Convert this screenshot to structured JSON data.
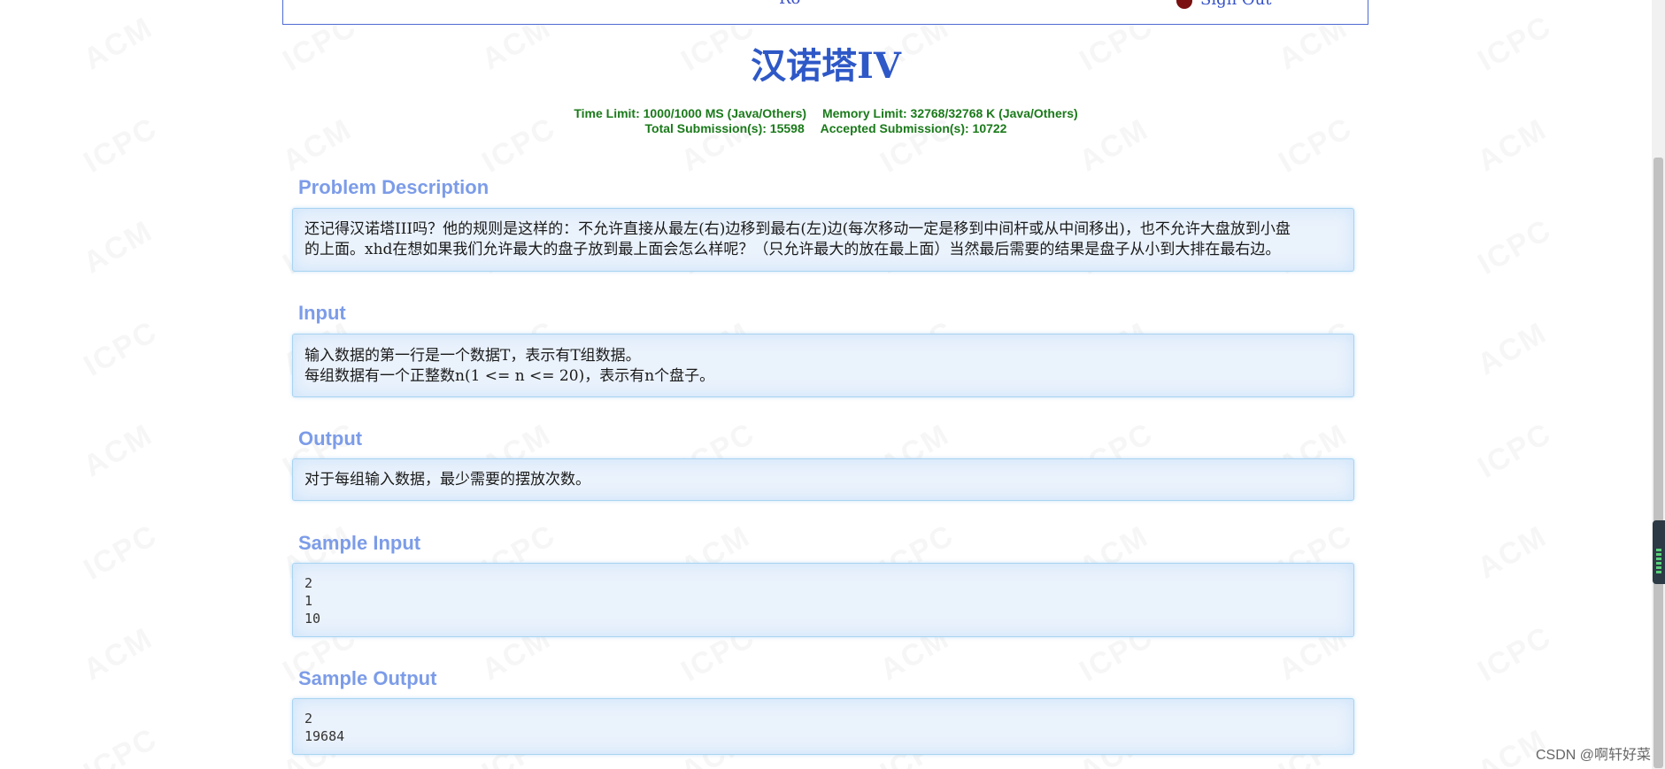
{
  "header": {
    "partial_text": "Ro",
    "signout_label": "Sign Out"
  },
  "problem": {
    "title": "汉诺塔IV",
    "time_limit": "Time Limit: 1000/1000 MS (Java/Others)",
    "memory_limit": "Memory Limit: 32768/32768 K (Java/Others)",
    "total_submissions": "Total Submission(s): 15598",
    "accepted_submissions": "Accepted Submission(s): 10722"
  },
  "sections": {
    "description": {
      "title": "Problem Description",
      "lines": [
        "还记得汉诺塔III吗？他的规则是这样的：不允许直接从最左(右)边移到最右(左)边(每次移动一定是移到中间杆或从中间移出)，也不允许大盘放到小盘",
        "的上面。xhd在想如果我们允许最大的盘子放到最上面会怎么样呢？（只允许最大的放在最上面）当然最后需要的结果是盘子从小到大排在最右边。"
      ]
    },
    "input": {
      "title": "Input",
      "lines": [
        "输入数据的第一行是一个数据T，表示有T组数据。",
        "每组数据有一个正整数n(1 <= n <= 20)，表示有n个盘子。"
      ]
    },
    "output": {
      "title": "Output",
      "lines": [
        "对于每组输入数据，最少需要的摆放次数。"
      ]
    },
    "sample_input": {
      "title": "Sample Input",
      "lines": [
        "2",
        "1",
        "10"
      ]
    },
    "sample_output": {
      "title": "Sample Output",
      "lines": [
        "2",
        "19684"
      ]
    }
  },
  "watermark": {
    "text1": "ACM",
    "text2": "ICPC"
  },
  "footer": {
    "credit": "CSDN @啊轩好菜"
  },
  "colors": {
    "title": "#2e58c7",
    "limits": "#1a7a1a",
    "section_title": "#7c9ce8",
    "panel_bg": "#eaf2fc",
    "panel_border": "#a8d4f2"
  }
}
